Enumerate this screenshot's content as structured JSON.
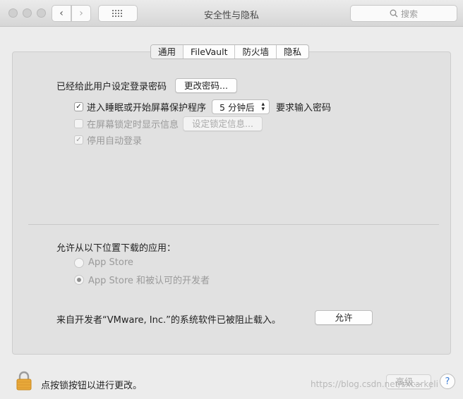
{
  "window": {
    "title": "安全性与隐私",
    "search_placeholder": "搜索"
  },
  "tabs": [
    {
      "label": "通用",
      "active": true
    },
    {
      "label": "FileVault",
      "active": false
    },
    {
      "label": "防火墙",
      "active": false
    },
    {
      "label": "隐私",
      "active": false
    }
  ],
  "general": {
    "password_set_text": "已经给此用户设定登录密码",
    "change_password_button": "更改密码...",
    "require_password": {
      "checked": true,
      "label": "进入睡眠或开始屏幕保护程序",
      "delay_value": "5 分钟后",
      "suffix": "要求输入密码"
    },
    "show_message": {
      "checked": false,
      "label": "在屏幕锁定时显示信息",
      "button": "设定锁定信息..."
    },
    "disable_auto_login": {
      "checked": true,
      "label": "停用自动登录"
    }
  },
  "downloads": {
    "heading": "允许从以下位置下载的应用：",
    "options": [
      {
        "label": "App Store",
        "selected": false
      },
      {
        "label": "App Store 和被认可的开发者",
        "selected": true
      }
    ]
  },
  "blocked": {
    "message": "来自开发者“VMware, Inc.”的系统软件已被阻止载入。",
    "allow_button": "允许"
  },
  "footer": {
    "lock_text": "点按锁按钮以进行更改。",
    "advanced_button": "高级...",
    "help_label": "?",
    "watermark": "https://blog.csdn.net/sxcarkeli"
  },
  "colors": {
    "lock": "#e8a83a",
    "help_accent": "#3a7bd5"
  }
}
